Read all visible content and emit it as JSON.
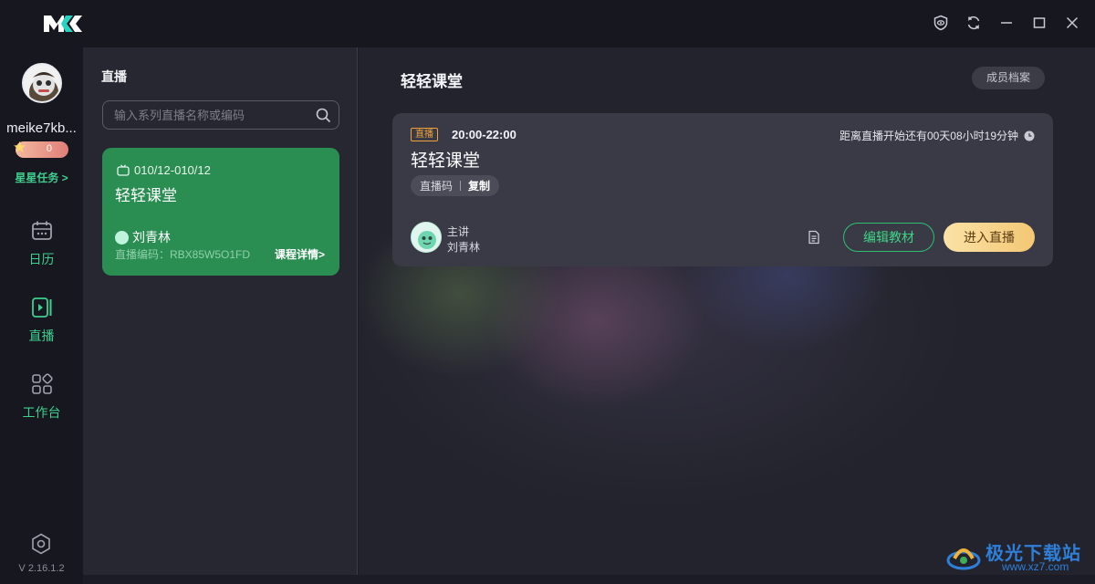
{
  "app": {
    "logo_icon": "mk-logo-icon",
    "window_controls": [
      "shield-eye-icon",
      "sync-icon",
      "minimize-icon",
      "maximize-icon",
      "close-icon"
    ]
  },
  "user": {
    "name": "meike7kb...",
    "level": "0",
    "tasks_link": "星星任务 >"
  },
  "nav": {
    "items": [
      {
        "label": "日历",
        "icon": "calendar-icon"
      },
      {
        "label": "直播",
        "icon": "live-video-icon",
        "active": true
      },
      {
        "label": "工作台",
        "icon": "workbench-grid-icon"
      }
    ],
    "version": "V 2.16.1.2"
  },
  "list": {
    "title": "直播",
    "search_placeholder": "输入系列直播名称或编码",
    "card": {
      "date_range": "010/12-010/12",
      "title": "轻轻课堂",
      "teacher": "刘青林",
      "code": "直播编码：RBX85W5O1FD",
      "detail_link": "课程详情>"
    }
  },
  "main": {
    "title": "轻轻课堂",
    "member_button": "成员档案",
    "session": {
      "badge": "直播",
      "time": "20:00-22:00",
      "countdown": "距离直播开始还有00天08小时19分钟",
      "title": "轻轻课堂",
      "code_label": "直播码",
      "copy_label": "复制",
      "host_role": "主讲",
      "host_name": "刘青林",
      "edit_button": "编辑教材",
      "enter_button": "进入直播"
    }
  },
  "watermark": {
    "name": "极光下载站",
    "url": "www.xz7.com"
  },
  "colors": {
    "accent_green": "#3ecf8e",
    "card_green": "#2a8d52",
    "badge_orange": "#f0a23a",
    "enter_button_gold": "#f3c775"
  }
}
